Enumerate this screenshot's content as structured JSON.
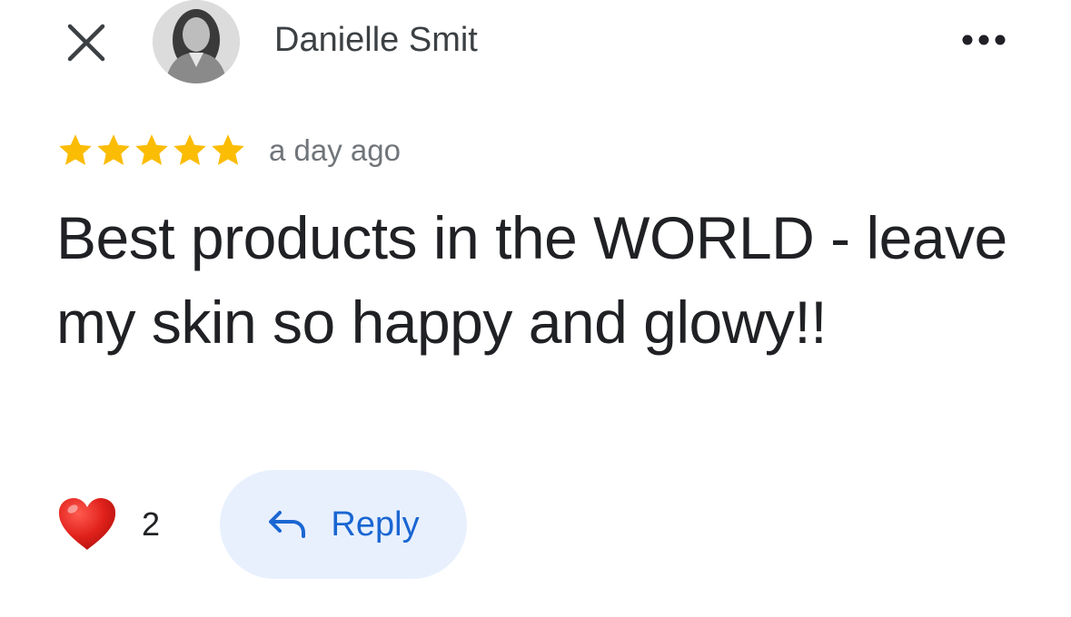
{
  "header": {
    "close_icon": "close-icon",
    "author_name": "Danielle Smit",
    "more_icon": "more-horizontal-icon"
  },
  "review": {
    "rating": 5,
    "rating_max": 5,
    "timestamp": "a day ago",
    "text": "Best products in the WORLD - leave my skin so happy and glowy!!"
  },
  "actions": {
    "like_icon": "heart-icon",
    "like_count": "2",
    "reply_icon": "reply-arrow-icon",
    "reply_label": "Reply"
  },
  "colors": {
    "star": "#fbbc04",
    "heart": "#e0211b",
    "reply_text": "#1a66d2",
    "reply_background": "#e8f0fe",
    "timestamp_text": "#70757a"
  }
}
